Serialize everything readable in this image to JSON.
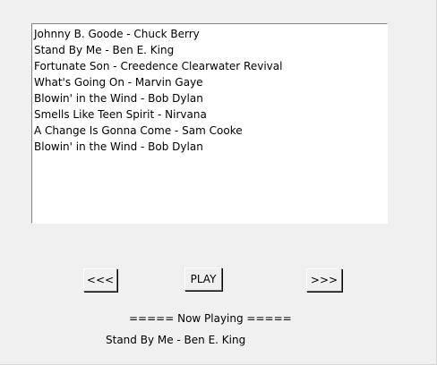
{
  "playlist": {
    "items": [
      "Johnny B. Goode - Chuck Berry",
      "Stand By Me - Ben E. King",
      "Fortunate Son - Creedence Clearwater Revival",
      "What's Going On - Marvin Gaye",
      "Blowin' in the Wind - Bob Dylan",
      "Smells Like Teen Spirit - Nirvana",
      "A Change Is Gonna Come - Sam Cooke",
      "Blowin' in the Wind - Bob Dylan"
    ]
  },
  "controls": {
    "prev_label": "<<<",
    "play_label": "PLAY",
    "next_label": ">>>"
  },
  "now_playing": {
    "header": "===== Now Playing =====",
    "song": "Stand By Me - Ben E. King"
  }
}
